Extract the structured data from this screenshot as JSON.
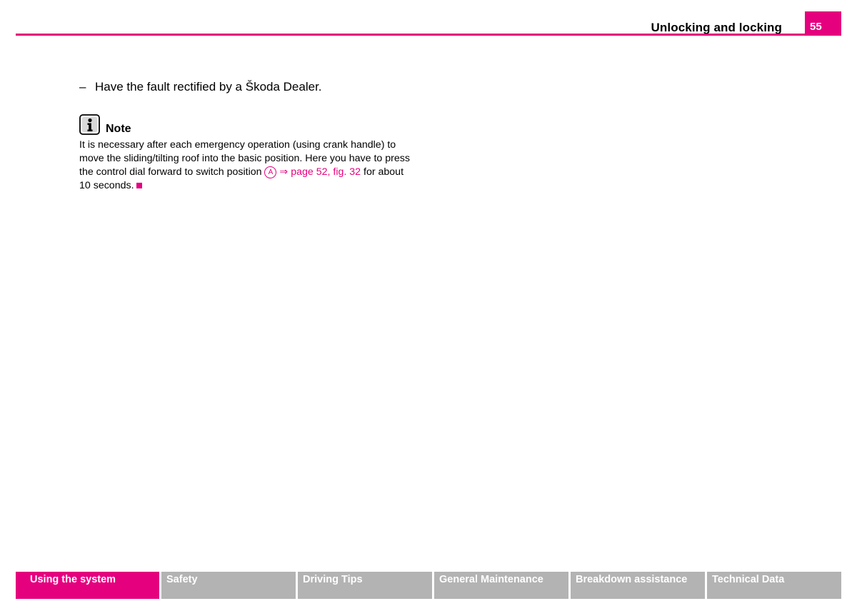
{
  "header": {
    "section_title": "Unlocking and locking",
    "page_number": "55"
  },
  "content": {
    "step_dash": "–",
    "step_text": "Have the fault rectified by a Škoda Dealer.",
    "note_title": "Note",
    "note_line1": "It is necessary after each emergency operation (using crank handle) to",
    "note_line2": "move the sliding/tilting roof into the basic position. Here you have to press",
    "note_line3_start": "the control dial forward to switch position",
    "position_letter": "A",
    "reference_link": "⇒ page 52, fig. 32",
    "note_line3_end": "for about",
    "note_line4": "10 seconds."
  },
  "footer": {
    "tabs": [
      {
        "label": "Using the system"
      },
      {
        "label": "Safety"
      },
      {
        "label": "Driving Tips"
      },
      {
        "label": "General Maintenance"
      },
      {
        "label": "Breakdown assistance"
      },
      {
        "label": "Technical Data"
      }
    ],
    "active_tab": "Using the system"
  },
  "colors": {
    "accent": "#e5007e",
    "tab_inactive": "#b3b3b3"
  },
  "icons": {
    "note": "info-icon",
    "end_of_section": "end-of-section-square"
  }
}
